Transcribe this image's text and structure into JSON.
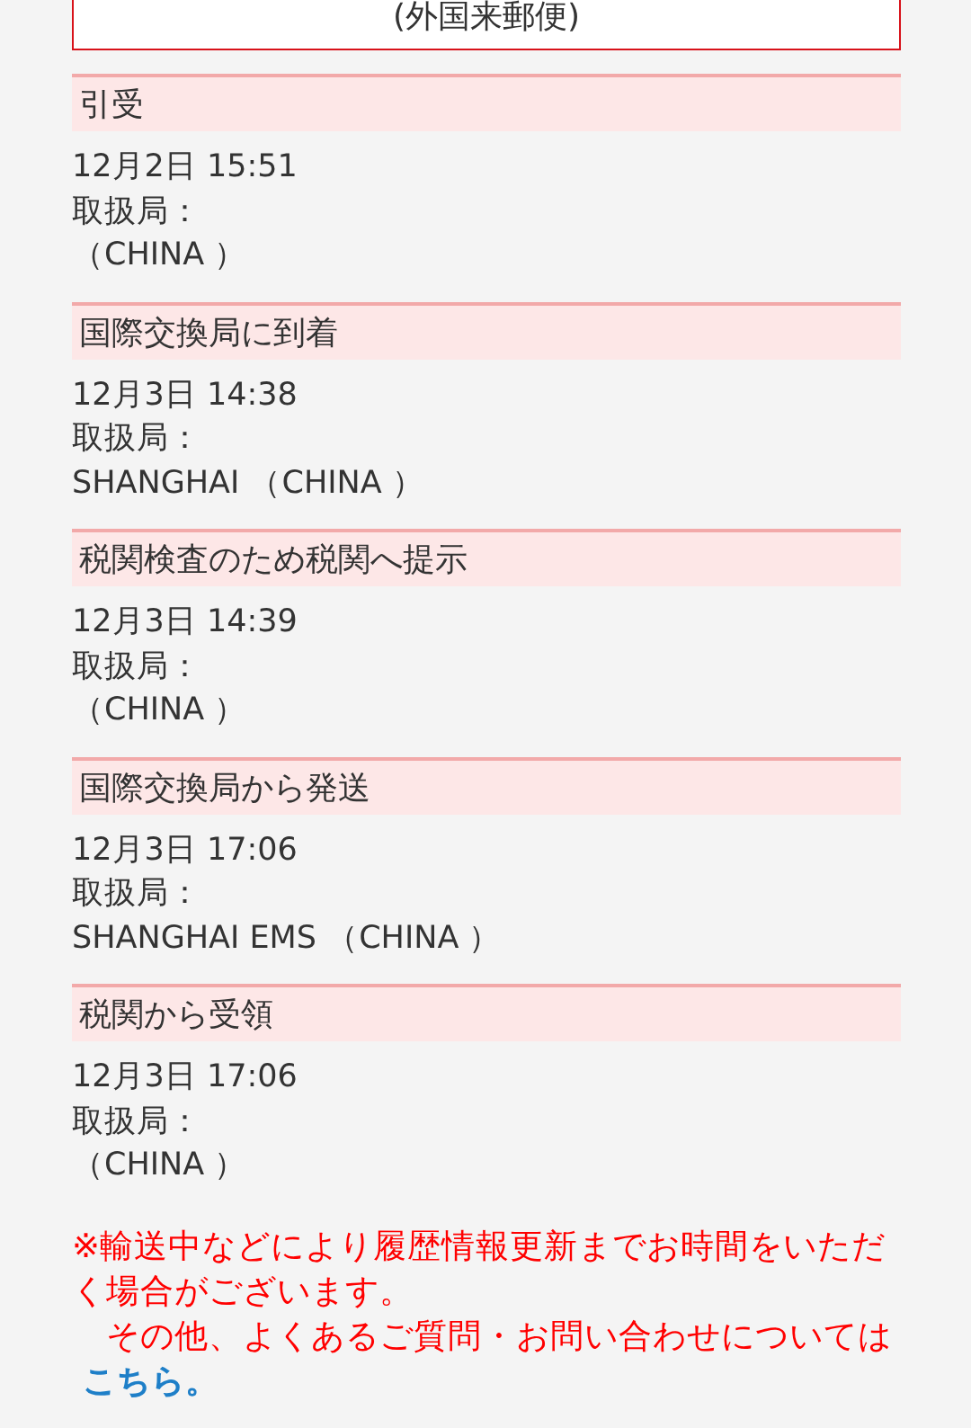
{
  "mail_type": "(外国来郵便)",
  "events": [
    {
      "status": "引受",
      "datetime": "12月2日 15:51",
      "office_label": "取扱局：",
      "office": "（CHINA ）"
    },
    {
      "status": "国際交換局に到着",
      "datetime": "12月3日 14:38",
      "office_label": "取扱局：",
      "office": "SHANGHAI （CHINA ）"
    },
    {
      "status": "税関検査のため税関へ提示",
      "datetime": "12月3日 14:39",
      "office_label": "取扱局：",
      "office": "（CHINA ）"
    },
    {
      "status": "国際交換局から発送",
      "datetime": "12月3日 17:06",
      "office_label": "取扱局：",
      "office": "SHANGHAI EMS （CHINA ）"
    },
    {
      "status": "税関から受領",
      "datetime": "12月3日 17:06",
      "office_label": "取扱局：",
      "office": "（CHINA ）"
    }
  ],
  "notice": {
    "text": "※輸送中などにより履歴情報更新までお時間をいただく場合がございます。",
    "inquiry_text": "　その他、よくあるご質問・お問い合わせについては",
    "link": "こちら。"
  }
}
